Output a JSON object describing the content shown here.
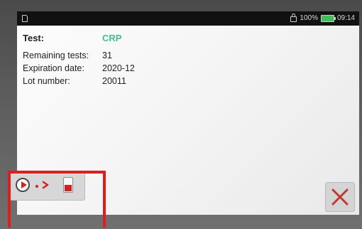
{
  "statusbar": {
    "battery": "100%",
    "time": "09:14"
  },
  "test": {
    "label": "Test:",
    "value": "CRP"
  },
  "details": [
    {
      "label": "Remaining tests:",
      "value": "31"
    },
    {
      "label": "Expiration date:",
      "value": "2020-12"
    },
    {
      "label": "Lot number:",
      "value": "20011"
    }
  ],
  "colors": {
    "test_value": "#3ec48a",
    "highlight": "#e21b1b",
    "accent_red": "#d62020"
  },
  "icons": {
    "start": [
      "play-icon",
      "arrow-icon",
      "cartridge-icon"
    ],
    "close": "close-icon"
  }
}
